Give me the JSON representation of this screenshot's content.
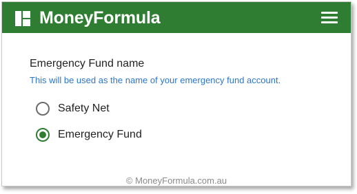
{
  "header": {
    "brand": "MoneyFormula",
    "logo_icon": "grid-logo-icon",
    "menu_icon": "hamburger-menu-icon",
    "background_color": "#2f7d32"
  },
  "question": {
    "title": "Emergency Fund name",
    "help_text": "This will be used as the name of your emergency fund account."
  },
  "options": [
    {
      "label": "Safety Net",
      "selected": false
    },
    {
      "label": "Emergency Fund",
      "selected": true
    }
  ],
  "footer": {
    "text": "© MoneyFormula.com.au"
  }
}
